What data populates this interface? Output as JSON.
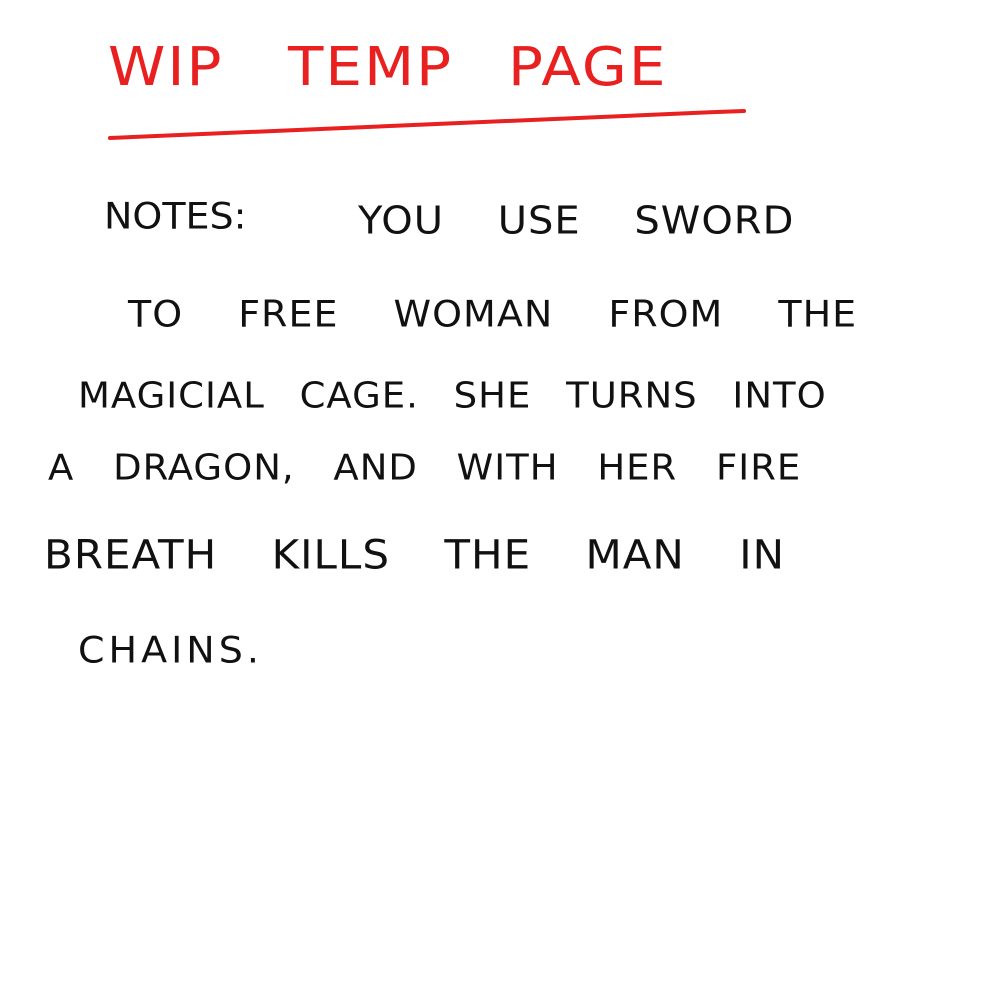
{
  "colors": {
    "title_red": "#e8201f",
    "ink": "#111111",
    "background": "#ffffff"
  },
  "title": {
    "words": [
      "WIP",
      "TEMP",
      "PAGE"
    ]
  },
  "notes": {
    "label": "NOTES:",
    "lines": [
      "YOU USE SWORD",
      "TO FREE WOMAN FROM THE",
      "MAGICIAL CAGE. SHE TURNS INTO",
      "A DRAGON, AND WITH HER FIRE",
      "BREATH KILLS THE MAN IN",
      "CHAINS."
    ]
  }
}
